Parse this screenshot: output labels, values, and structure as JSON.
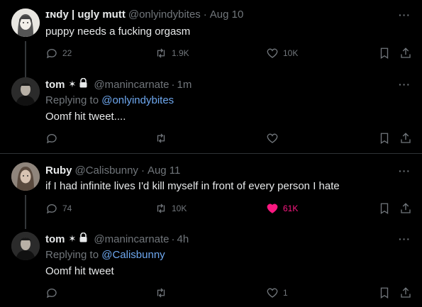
{
  "threads": [
    {
      "main": {
        "name": "ɪɴdy | ugly mutt",
        "handle": "@onlyindybites",
        "time": "Aug 10",
        "text": "puppy needs a fucking orgasm",
        "replies": "22",
        "retweets": "1.9K",
        "likes": "10K",
        "liked": false
      },
      "reply": {
        "name": "tom",
        "badge": "✶",
        "handle": "@manincarnate",
        "time": "1m",
        "replying_label": "Replying to",
        "replying_to": "@onlyindybites",
        "text": "Oomf hit tweet....",
        "replies": "",
        "retweets": "",
        "likes": ""
      }
    },
    {
      "main": {
        "name": "Ruby",
        "handle": "@Calisbunny",
        "time": "Aug 11",
        "text": "if I had infinite lives I'd kill myself in front of every person I hate",
        "replies": "74",
        "retweets": "10K",
        "likes": "61K",
        "liked": true
      },
      "reply": {
        "name": "tom",
        "badge": "✶",
        "handle": "@manincarnate",
        "time": "4h",
        "replying_label": "Replying to",
        "replying_to": "@Calisbunny",
        "text": "Oomf hit tweet",
        "replies": "",
        "retweets": "",
        "likes": "1"
      }
    }
  ],
  "separator": "·",
  "more_label": "···",
  "colors": {
    "like_active": "#f91880",
    "mention": "#6ea8f0",
    "muted": "#71767b"
  }
}
